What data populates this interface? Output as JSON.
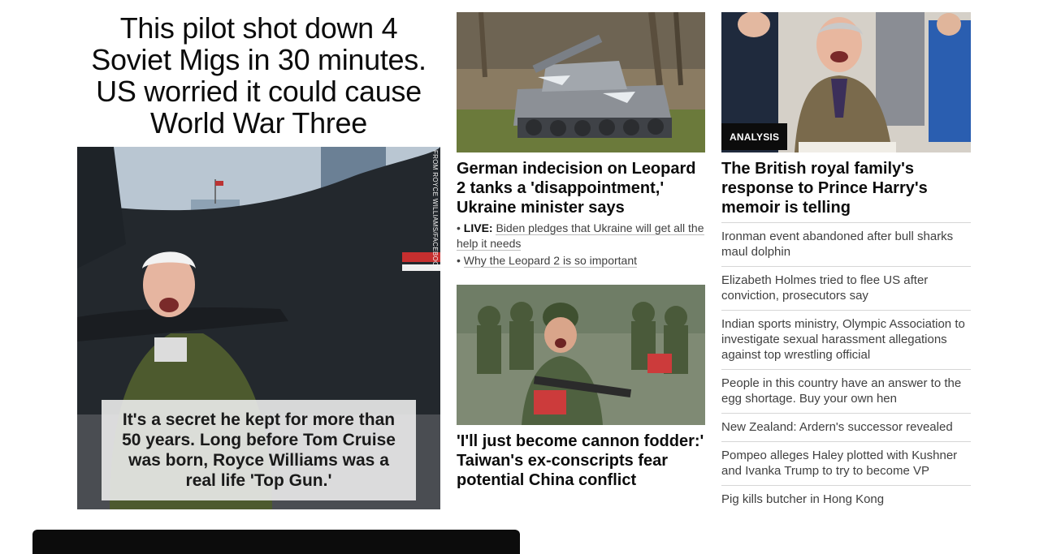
{
  "hero": {
    "title": "This pilot shot down 4 Soviet Migs in 30 minutes. US worried it could cause World War Three",
    "image_credit": "FROM ROYCE WILLIAMS/FACEBOOK",
    "caption": "It's a secret he kept for more than 50 years. Long before Tom Cruise was born, Royce Williams was a real life 'Top Gun.'"
  },
  "middle": {
    "story1": {
      "headline": "German indecision on Leopard 2 tanks a 'disappointment,' Ukraine minister says",
      "related": [
        {
          "bullet": "•",
          "prefix": "LIVE:",
          "text": "Biden pledges that Ukraine will get all the help it needs"
        },
        {
          "bullet": "•",
          "prefix": "",
          "text": "Why the Leopard 2 is so important"
        }
      ]
    },
    "story2": {
      "headline": "'I'll just become cannon fodder:' Taiwan's ex-conscripts fear potential China conflict"
    }
  },
  "right": {
    "badge": "ANALYSIS",
    "headline": "The British royal family's response to Prince Harry's memoir is telling",
    "links": [
      "Ironman event abandoned after bull sharks maul dolphin",
      "Elizabeth Holmes tried to flee US after conviction, prosecutors say",
      "Indian sports ministry, Olympic Association to investigate sexual harassment allegations against top wrestling official",
      "People in this country have an answer to the egg shortage. Buy your own hen",
      "New Zealand: Ardern's successor revealed",
      "Pompeo alleges Haley plotted with Kushner and Ivanka Trump to try to become VP",
      "Pig kills butcher in Hong Kong"
    ]
  }
}
